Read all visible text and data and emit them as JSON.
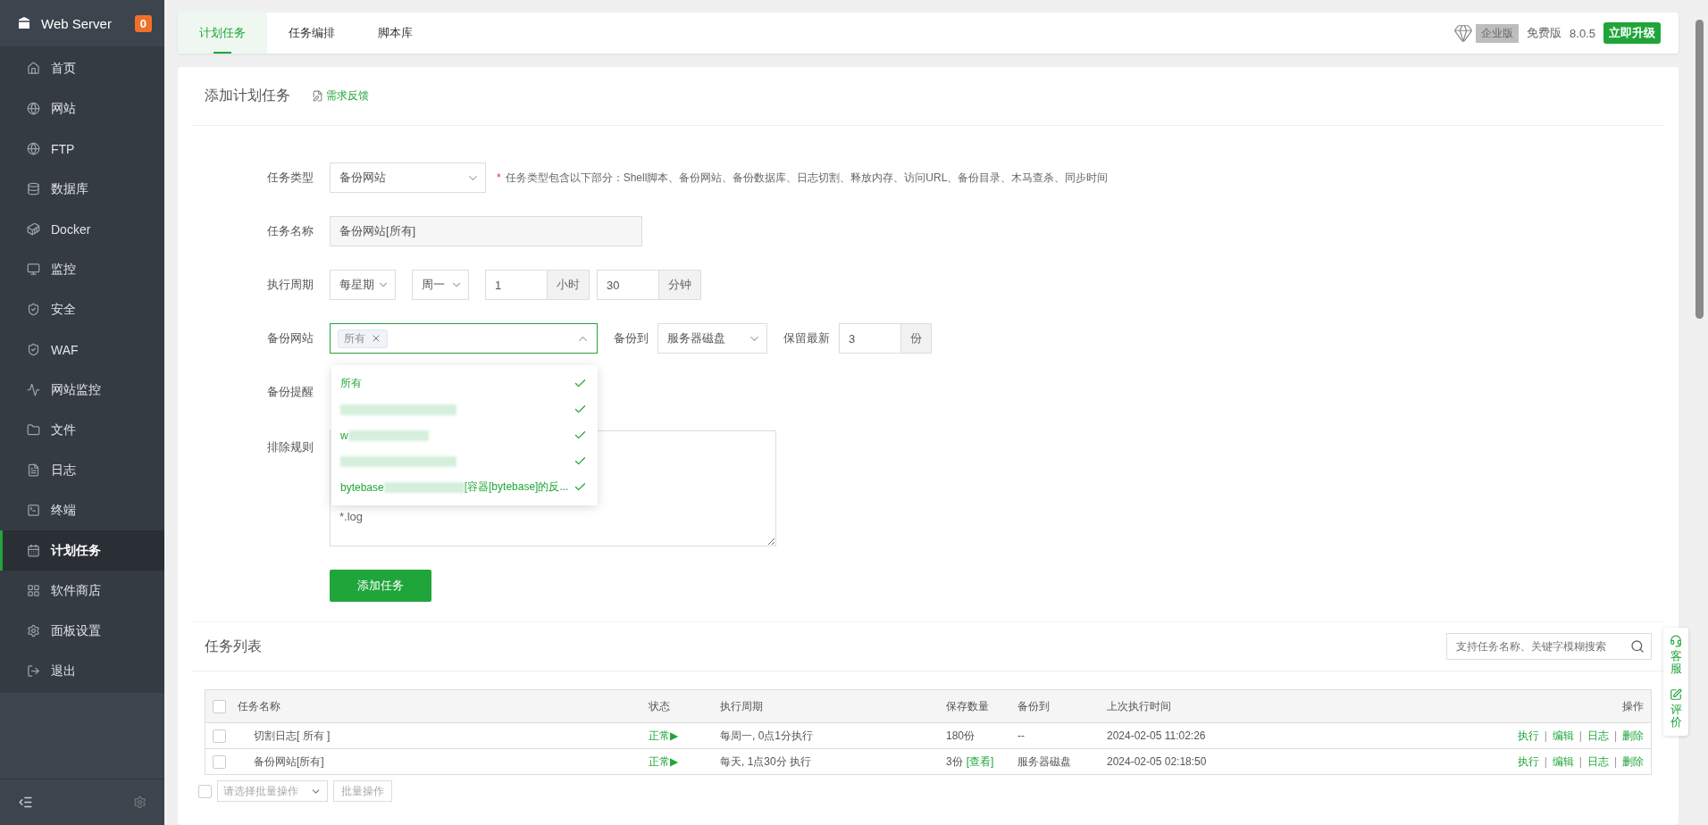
{
  "sidebar": {
    "title": "Web Server",
    "badge": "0",
    "items": [
      {
        "label": "首页",
        "selected": false
      },
      {
        "label": "网站",
        "selected": false
      },
      {
        "label": "FTP",
        "selected": false
      },
      {
        "label": "数据库",
        "selected": false
      },
      {
        "label": "Docker",
        "selected": false
      },
      {
        "label": "监控",
        "selected": false
      },
      {
        "label": "安全",
        "selected": false
      },
      {
        "label": "WAF",
        "selected": false
      },
      {
        "label": "网站监控",
        "selected": false
      },
      {
        "label": "文件",
        "selected": false
      },
      {
        "label": "日志",
        "selected": false
      },
      {
        "label": "终端",
        "selected": false
      },
      {
        "label": "计划任务",
        "selected": true
      },
      {
        "label": "软件商店",
        "selected": false
      },
      {
        "label": "面板设置",
        "selected": false
      },
      {
        "label": "退出",
        "selected": false
      }
    ]
  },
  "tabs": [
    {
      "label": "计划任务",
      "selected": true
    },
    {
      "label": "任务编排",
      "selected": false
    },
    {
      "label": "脚本库",
      "selected": false
    }
  ],
  "edition": {
    "tag": "企业版",
    "plan": "免费版",
    "version": "8.0.5",
    "upgrade": "立即升级"
  },
  "form": {
    "title": "添加计划任务",
    "feedback": "需求反馈",
    "task_type": {
      "label": "任务类型",
      "value": "备份网站",
      "required_mark": "*",
      "hint": "任务类型包含以下部分：Shell脚本、备份网站、备份数据库、日志切割、释放内存、访问URL、备份目录、木马查杀、同步时间"
    },
    "task_name": {
      "label": "任务名称",
      "value": "备份网站[所有]"
    },
    "cycle": {
      "label": "执行周期",
      "period": "每星期",
      "weekday": "周一",
      "hour": "1",
      "hour_unit": "小时",
      "minute": "30",
      "minute_unit": "分钟"
    },
    "backup_site": {
      "label": "备份网站",
      "tag": "所有",
      "expanded": true,
      "options": [
        {
          "text": "所有",
          "redacted": false,
          "checked": true
        },
        {
          "redacted": true,
          "checked": true
        },
        {
          "text": "w",
          "redacted": true,
          "checked": true
        },
        {
          "redacted": true,
          "checked": true
        },
        {
          "text": "bytebase",
          "suffix": "[容器[bytebase]的反...",
          "redacted": true,
          "checked": true
        }
      ],
      "target_label": "备份到",
      "target": "服务器磁盘",
      "keep_label": "保留最新",
      "keep": "3",
      "keep_unit": "份"
    },
    "notify": {
      "label": "备份提醒"
    },
    "exclude": {
      "label": "排除规则",
      "value": "*.log"
    },
    "submit": "添加任务"
  },
  "list": {
    "title": "任务列表",
    "search": {
      "placeholder": "支持任务名称、关键字模糊搜索"
    },
    "columns": [
      "任务名称",
      "状态",
      "执行周期",
      "保存数量",
      "备份到",
      "上次执行时间",
      "操作"
    ],
    "header_checked": false,
    "rows": [
      {
        "checked": false,
        "name": "切割日志[ 所有 ]",
        "status": "正常▶",
        "cycle": "每周一, 0点1分执行",
        "keep": "180份",
        "target": "--",
        "last_run": "2024-02-05 11:02:26",
        "actions": [
          "执行",
          "编辑",
          "日志",
          "删除"
        ],
        "separators": [
          "|",
          "|",
          "|"
        ]
      },
      {
        "checked": false,
        "name": "备份网站[所有]",
        "status": "正常▶",
        "cycle": "每天, 1点30分 执行",
        "keep": "3份",
        "keep_link": "[查看]",
        "target": "服务器磁盘",
        "last_run": "2024-02-05 02:18:50",
        "actions": [
          "执行",
          "编辑",
          "日志",
          "删除"
        ],
        "separators": [
          "|",
          "|",
          "|"
        ]
      }
    ],
    "batch": {
      "checked": false,
      "placeholder": "请选择批量操作",
      "button": "批量操作"
    }
  },
  "float_panel": [
    {
      "label": "客服"
    },
    {
      "label": "评价"
    }
  ]
}
